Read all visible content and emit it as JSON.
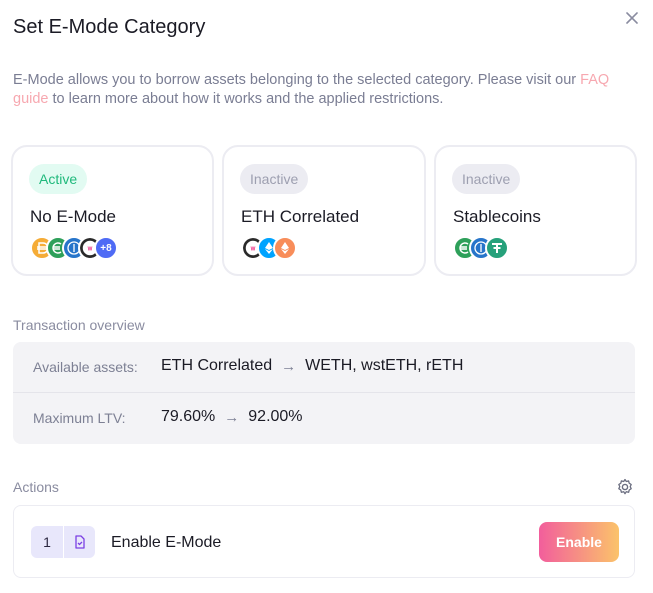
{
  "modal": {
    "title": "Set E-Mode Category",
    "description_pre": "E-Mode allows you to borrow assets belonging to the selected category. Please visit our ",
    "description_link": "FAQ guide",
    "description_post": " to learn more about how it works and the applied restrictions."
  },
  "categories": [
    {
      "status": "Active",
      "name": "No E-Mode",
      "icons": [
        "dai-icon",
        "euro-stablecoin-icon",
        "usdc-icon",
        "weth-icon"
      ],
      "more": "+8"
    },
    {
      "status": "Inactive",
      "name": "ETH Correlated",
      "icons": [
        "weth-icon",
        "wsteth-icon",
        "reth-icon"
      ]
    },
    {
      "status": "Inactive",
      "name": "Stablecoins",
      "icons": [
        "euro-stablecoin-icon",
        "usdc-icon",
        "usdt-icon"
      ]
    }
  ],
  "overview": {
    "label": "Transaction overview",
    "assets_key": "Available assets:",
    "assets_from": "ETH Correlated",
    "assets_to": "WETH, wstETH, rETH",
    "ltv_key": "Maximum LTV:",
    "ltv_from": "79.60%",
    "ltv_to": "92.00%",
    "arrow": "→"
  },
  "actions": {
    "label": "Actions",
    "step_number": "1",
    "step_label": "Enable E-Mode",
    "button": "Enable"
  },
  "colors": {
    "active_pill": "#20b97c",
    "link": "#f7a8b0",
    "button_gradient_start": "#f25e9c",
    "button_gradient_end": "#fbc36a"
  }
}
